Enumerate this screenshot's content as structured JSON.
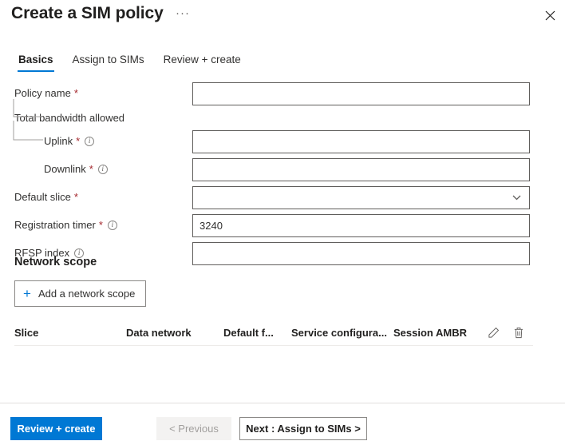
{
  "header": {
    "title": "Create a SIM policy",
    "more_label": "···",
    "close_icon": "close-icon"
  },
  "tabs": [
    {
      "label": "Basics",
      "active": true
    },
    {
      "label": "Assign to SIMs",
      "active": false
    },
    {
      "label": "Review + create",
      "active": false
    }
  ],
  "form": {
    "policy_name": {
      "label": "Policy name",
      "required": "*",
      "value": "",
      "placeholder": ""
    },
    "total_bandwidth": {
      "label": "Total bandwidth allowed"
    },
    "uplink": {
      "label": "Uplink",
      "required": "*",
      "info": "info-icon",
      "value": "",
      "placeholder": ""
    },
    "downlink": {
      "label": "Downlink",
      "required": "*",
      "info": "info-icon",
      "value": "",
      "placeholder": ""
    },
    "default_slice": {
      "label": "Default slice",
      "required": "*",
      "value": "",
      "chevron": "chevron-down-icon"
    },
    "registration_timer": {
      "label": "Registration timer",
      "required": "*",
      "info": "info-icon",
      "value": "3240",
      "placeholder": ""
    },
    "rfsp_index": {
      "label": "RFSP index",
      "info": "info-icon",
      "value": "",
      "placeholder": ""
    }
  },
  "network_scope": {
    "title": "Network scope",
    "add_button": "Add a network scope",
    "plus_icon": "plus-icon",
    "table": {
      "columns": [
        "Slice",
        "Data network",
        "Default f...",
        "Service configura...",
        "Session AMBR"
      ],
      "edit_icon": "pencil-icon",
      "delete_icon": "trash-icon",
      "rows": []
    }
  },
  "footer": {
    "review_create": "Review + create",
    "previous": "< Previous",
    "next": "Next : Assign to SIMs >"
  },
  "colors": {
    "accent": "#0078d4",
    "required": "#a4262c",
    "border": "#605e5c",
    "text": "#323130"
  }
}
